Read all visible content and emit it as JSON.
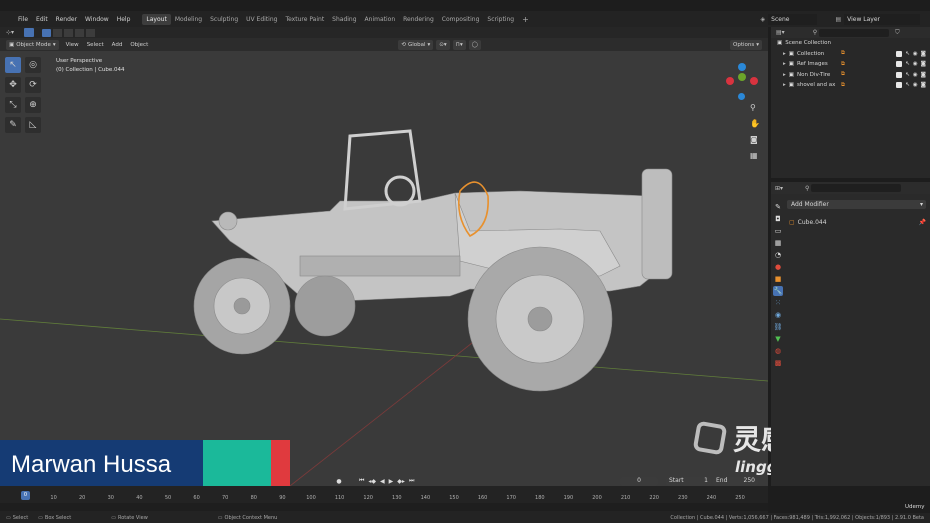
{
  "menu": [
    "File",
    "Edit",
    "Render",
    "Window",
    "Help"
  ],
  "workspaces": [
    {
      "label": "Layout",
      "active": true
    },
    {
      "label": "Modeling",
      "active": false
    },
    {
      "label": "Sculpting",
      "active": false
    },
    {
      "label": "UV Editing",
      "active": false
    },
    {
      "label": "Texture Paint",
      "active": false
    },
    {
      "label": "Shading",
      "active": false
    },
    {
      "label": "Animation",
      "active": false
    },
    {
      "label": "Rendering",
      "active": false
    },
    {
      "label": "Compositing",
      "active": false
    },
    {
      "label": "Scripting",
      "active": false
    }
  ],
  "top_right": {
    "scene": "Scene",
    "view_layer": "View Layer"
  },
  "viewport_header": {
    "mode": "Object Mode",
    "menus": [
      "View",
      "Select",
      "Add",
      "Object"
    ],
    "orientation": "Global",
    "options": "Options"
  },
  "viewport_overlay": {
    "title": "User Perspective",
    "subtitle": "(0) Collection | Cube.044"
  },
  "outliner": {
    "root": "Scene Collection",
    "items": [
      "Collection",
      "Ref Images",
      "Non Div-Tire",
      "shovel and ax"
    ]
  },
  "properties": {
    "add_modifier": "Add Modifier",
    "object_name": "Cube.044"
  },
  "timeline": {
    "current_frame_value": "0",
    "start_label": "Start",
    "start_value": "1",
    "end_label": "End",
    "end_value": "250",
    "playhead": "0",
    "ticks": [
      "10",
      "20",
      "30",
      "40",
      "50",
      "60",
      "70",
      "80",
      "90",
      "100",
      "110",
      "120",
      "130",
      "140",
      "150",
      "160",
      "170",
      "180",
      "190",
      "200",
      "210",
      "220",
      "230",
      "240",
      "250"
    ]
  },
  "status": {
    "select": "Select",
    "box_select": "Box Select",
    "rotate_view": "Rotate View",
    "context_menu": "Object Context Menu",
    "stats": "Collection | Cube.044 | Verts:1,056,667 | Faces:981,489 | Tris:1,992,062 | Objects:1/893 | 2.91.0 Beta"
  },
  "lower_third": {
    "name": "Marwan Hussa"
  },
  "watermark": {
    "brand_cn": "灵感中国",
    "brand_url": "lingganchina.com",
    "udemy": "Udemy"
  },
  "colors": {
    "accent": "#4772b3",
    "teal": "#1bb99a",
    "red": "#e03a3e",
    "navy": "#153b74",
    "selection": "#e8912e"
  }
}
